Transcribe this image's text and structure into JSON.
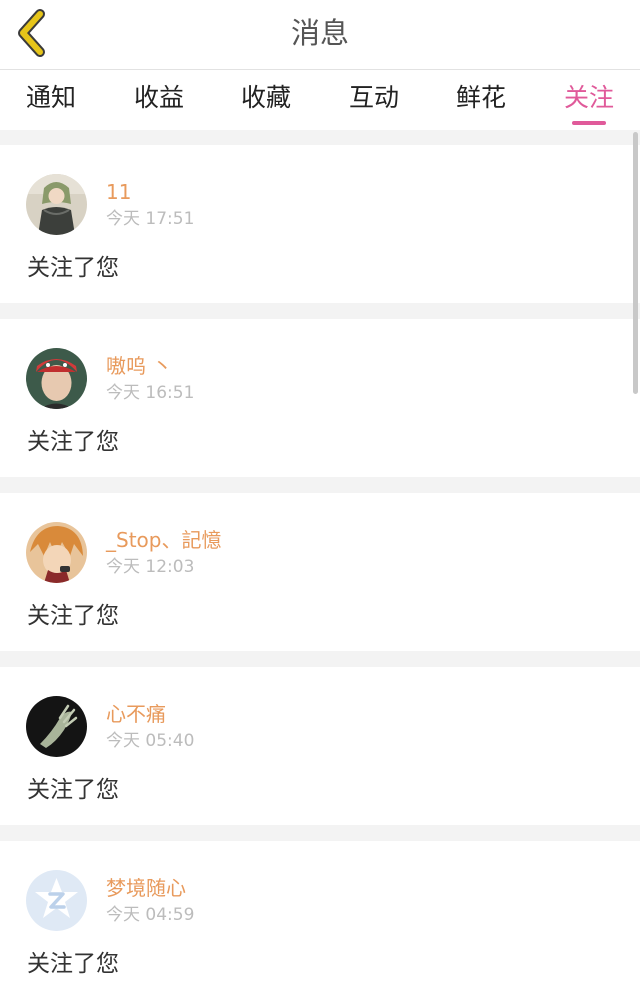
{
  "header": {
    "title": "消息",
    "back_icon": "chevron-left-icon",
    "back_color": "#e6c51a"
  },
  "tabs": [
    {
      "label": "通知"
    },
    {
      "label": "收益"
    },
    {
      "label": "收藏"
    },
    {
      "label": "互动"
    },
    {
      "label": "鲜花"
    },
    {
      "label": "关注",
      "active": true
    }
  ],
  "colors": {
    "accent": "#e05a9a",
    "username": "#e89a5c",
    "timestamp": "#bcbcbc"
  },
  "notifications": [
    {
      "username": "11",
      "time": "今天 17:51",
      "action": "关注了您"
    },
    {
      "username": "嗷呜 丶",
      "time": "今天 16:51",
      "action": "关注了您"
    },
    {
      "username": "_Stop、記憶",
      "time": "今天 12:03",
      "action": "关注了您"
    },
    {
      "username": "心不痛",
      "time": "今天 05:40",
      "action": "关注了您"
    },
    {
      "username": "梦境随心",
      "time": "今天 04:59",
      "action": "关注了您"
    }
  ]
}
